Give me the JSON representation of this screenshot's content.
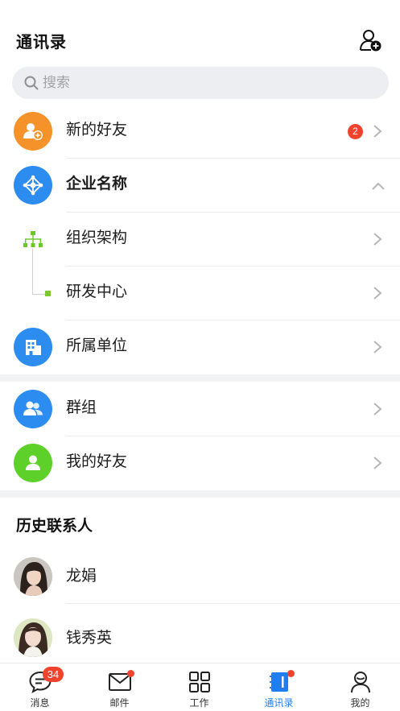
{
  "header": {
    "title": "通讯录"
  },
  "search": {
    "placeholder": "搜索"
  },
  "rows": {
    "new_friends": {
      "label": "新的好友",
      "badge": "2"
    },
    "company": {
      "label": "企业名称"
    },
    "org": {
      "label": "组织架构"
    },
    "rnd": {
      "label": "研发中心"
    },
    "unit": {
      "label": "所属单位"
    },
    "groups": {
      "label": "群组"
    },
    "my_friends": {
      "label": "我的好友"
    }
  },
  "history": {
    "title": "历史联系人",
    "contacts": [
      {
        "name": "龙娟"
      },
      {
        "name": "钱秀英"
      }
    ]
  },
  "tabbar": {
    "items": [
      {
        "label": "消息",
        "icon": "chat-icon",
        "badge": "34"
      },
      {
        "label": "邮件",
        "icon": "mail-icon"
      },
      {
        "label": "工作",
        "icon": "grid-icon"
      },
      {
        "label": "通讯录",
        "icon": "contacts-book-icon",
        "active": true
      },
      {
        "label": "我的",
        "icon": "profile-icon"
      }
    ]
  },
  "colors": {
    "accent": "#1f7ff0",
    "orange": "#f5932a",
    "blue": "#2d8cf0",
    "green": "#5dd12a",
    "badge": "#f0432d"
  }
}
